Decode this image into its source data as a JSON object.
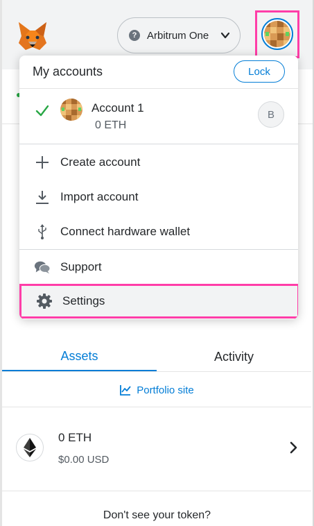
{
  "header": {
    "network_label": "Arbitrum One",
    "network_help_glyph": "?",
    "logo_icon": "metamask-fox-icon",
    "account_avatar_icon": "identicon-avatar"
  },
  "assets_tabs": [
    {
      "label": "Assets"
    },
    {
      "label": "Activity"
    }
  ],
  "portfolio_link": "Portfolio site",
  "token": {
    "amount": "0 ETH",
    "fiat": "$0.00 USD",
    "icon": "ethereum-icon"
  },
  "dont_see_token": "Don't see your token?",
  "account_menu": {
    "title": "My accounts",
    "lock_label": "Lock",
    "accounts": [
      {
        "name": "Account 1",
        "balance": "0 ETH",
        "badge": "B",
        "selected": true
      }
    ],
    "items": [
      {
        "label": "Create account",
        "icon": "plus-icon"
      },
      {
        "label": "Import account",
        "icon": "download-icon"
      },
      {
        "label": "Connect hardware wallet",
        "icon": "usb-icon"
      },
      {
        "label": "Support",
        "icon": "chat-bubbles-icon"
      },
      {
        "label": "Settings",
        "icon": "gear-icon"
      }
    ]
  },
  "colors": {
    "accent": "#037dd6",
    "highlight_box": "#ff3da8",
    "success": "#28a745",
    "header_bg": "#f2f3f4",
    "text": "#24272a"
  }
}
